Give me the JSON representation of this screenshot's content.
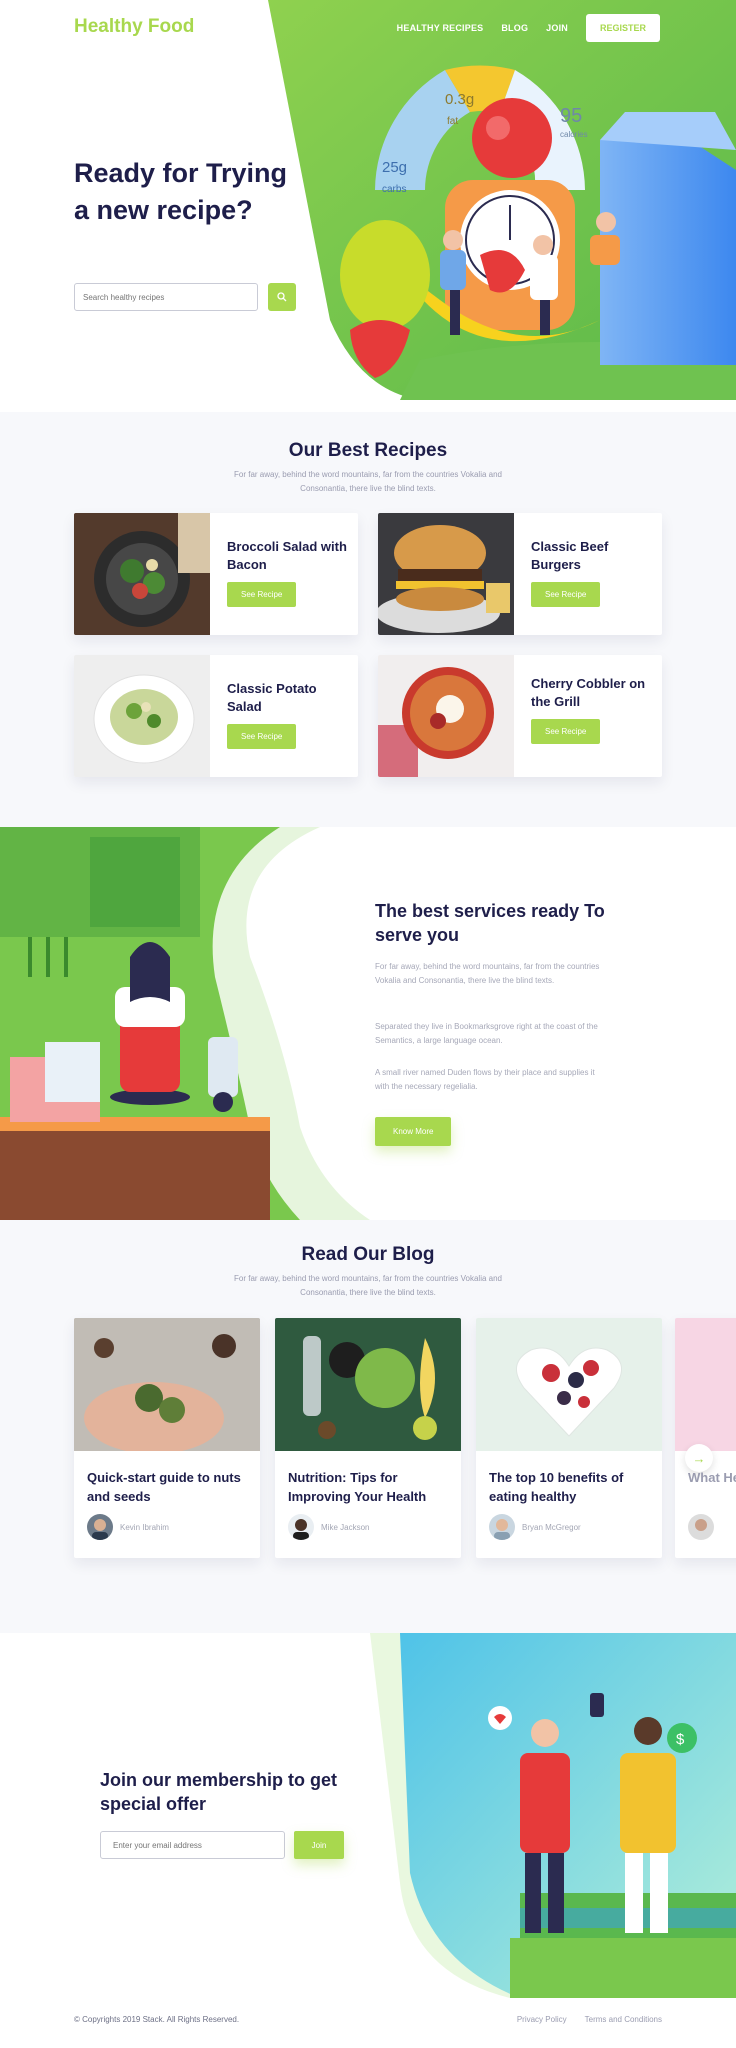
{
  "header": {
    "logo": "Healthy Food",
    "nav": [
      "HEALTHY RECIPES",
      "BLOG",
      "JOIN"
    ],
    "register_label": "REGISTER"
  },
  "hero": {
    "title": "Ready for Trying a new recipe?",
    "search_placeholder": "Search healthy recipes",
    "stats": [
      {
        "value": "0.3g",
        "label": "fat"
      },
      {
        "value": "95",
        "label": "calories"
      },
      {
        "value": "25g",
        "label": "carbs"
      }
    ]
  },
  "recipes": {
    "title": "Our Best Recipes",
    "subtitle": "For far away, behind the word mountains, far from the countries Vokalia and Consonantia, there live the blind texts.",
    "button_label": "See Recipe",
    "items": [
      {
        "name": "Broccoli Salad with Bacon"
      },
      {
        "name": "Classic Beef Burgers"
      },
      {
        "name": "Classic Potato Salad"
      },
      {
        "name": "Cherry Cobbler on the Grill"
      }
    ]
  },
  "services": {
    "title": "The best services ready To serve you",
    "paragraphs": [
      "For far away, behind the word mountains, far from the countries Vokalia and Consonantia, there live the blind texts.",
      "Separated they live in Bookmarksgrove right at the coast of the Semantics, a large language ocean.",
      "A small river named Duden flows by their place and supplies it with the necessary regelialia."
    ],
    "button_label": "Know More"
  },
  "blog": {
    "title": "Read Our Blog",
    "subtitle": "For far away, behind the word mountains, far from the countries Vokalia and Consonantia, there live the blind texts.",
    "posts": [
      {
        "title": "Quick-start guide to nuts and seeds",
        "author": "Kevin Ibrahim"
      },
      {
        "title": "Nutrition: Tips for Improving Your Health",
        "author": "Mike Jackson"
      },
      {
        "title": "The top 10 benefits of eating healthy",
        "author": "Bryan McGregor"
      },
      {
        "title": "What Health",
        "author": ""
      }
    ]
  },
  "membership": {
    "title": "Join our membership to get special offer",
    "email_placeholder": "Enter your email address",
    "join_label": "Join"
  },
  "footer": {
    "copyright": "© Copyrights 2019 Stack. All Rights Reserved.",
    "links": [
      "Privacy Policy",
      "Terms and Conditions"
    ]
  },
  "colors": {
    "accent": "#a8d84e",
    "heading": "#1e1e4a",
    "muted": "#9a9cb0"
  }
}
